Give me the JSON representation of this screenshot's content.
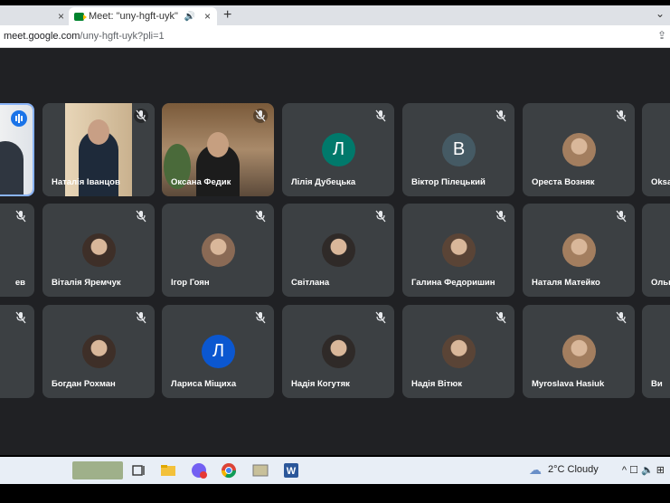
{
  "browser": {
    "tabs": [
      {
        "label": ""
      },
      {
        "label": "Meet: \"uny-hgft-uyk\""
      }
    ],
    "new_tab": "+",
    "tab_menu": "⌄",
    "close": "×",
    "url_host": "meet.google.com",
    "url_path": "/uny-hgft-uyk?pli=1"
  },
  "participants": [
    {
      "name": "",
      "tile": "self-video",
      "speaking": true
    },
    {
      "name": "Наталія Іванцов",
      "tile": "video"
    },
    {
      "name": "Оксана Федик",
      "tile": "video"
    },
    {
      "name": "Лілія Дубецька",
      "tile": "initial",
      "initial": "Л",
      "color": "#00796b"
    },
    {
      "name": "Віктор Пілецький",
      "tile": "initial",
      "initial": "В",
      "color": "#455a64"
    },
    {
      "name": "Ореста Возняк",
      "tile": "photo"
    },
    {
      "name": "Oksa",
      "tile": "partial"
    },
    {
      "name": "ев",
      "tile": "partial-left"
    },
    {
      "name": "Віталія Яремчук",
      "tile": "photo"
    },
    {
      "name": "Ігор Гоян",
      "tile": "photo"
    },
    {
      "name": "Світлана",
      "tile": "photo"
    },
    {
      "name": "Галина Федоришин",
      "tile": "photo"
    },
    {
      "name": "Наталя Матейко",
      "tile": "photo"
    },
    {
      "name": "Ольг",
      "tile": "partial"
    },
    {
      "name": "",
      "tile": "partial-left"
    },
    {
      "name": "Богдан Рохман",
      "tile": "photo"
    },
    {
      "name": "Лариса Міщиха",
      "tile": "initial",
      "initial": "Л",
      "color": "#0b57d0"
    },
    {
      "name": "Надія Когутяк",
      "tile": "photo"
    },
    {
      "name": "Надія Вітюк",
      "tile": "photo"
    },
    {
      "name": "Myroslava Hasiuk",
      "tile": "photo"
    },
    {
      "name": "Ви",
      "tile": "partial"
    }
  ],
  "meeting": {
    "code": "ft-uyk",
    "mic_badge": "!",
    "cam_badge": "!",
    "info": "i"
  },
  "taskbar": {
    "weather": "2°C  Cloudy",
    "tray": "^  ☐  🔈  ⊞"
  },
  "colors": {
    "meet_bg": "#202124",
    "tile_bg": "#3c4043",
    "red": "#ea4335",
    "badge": "#f29900"
  }
}
